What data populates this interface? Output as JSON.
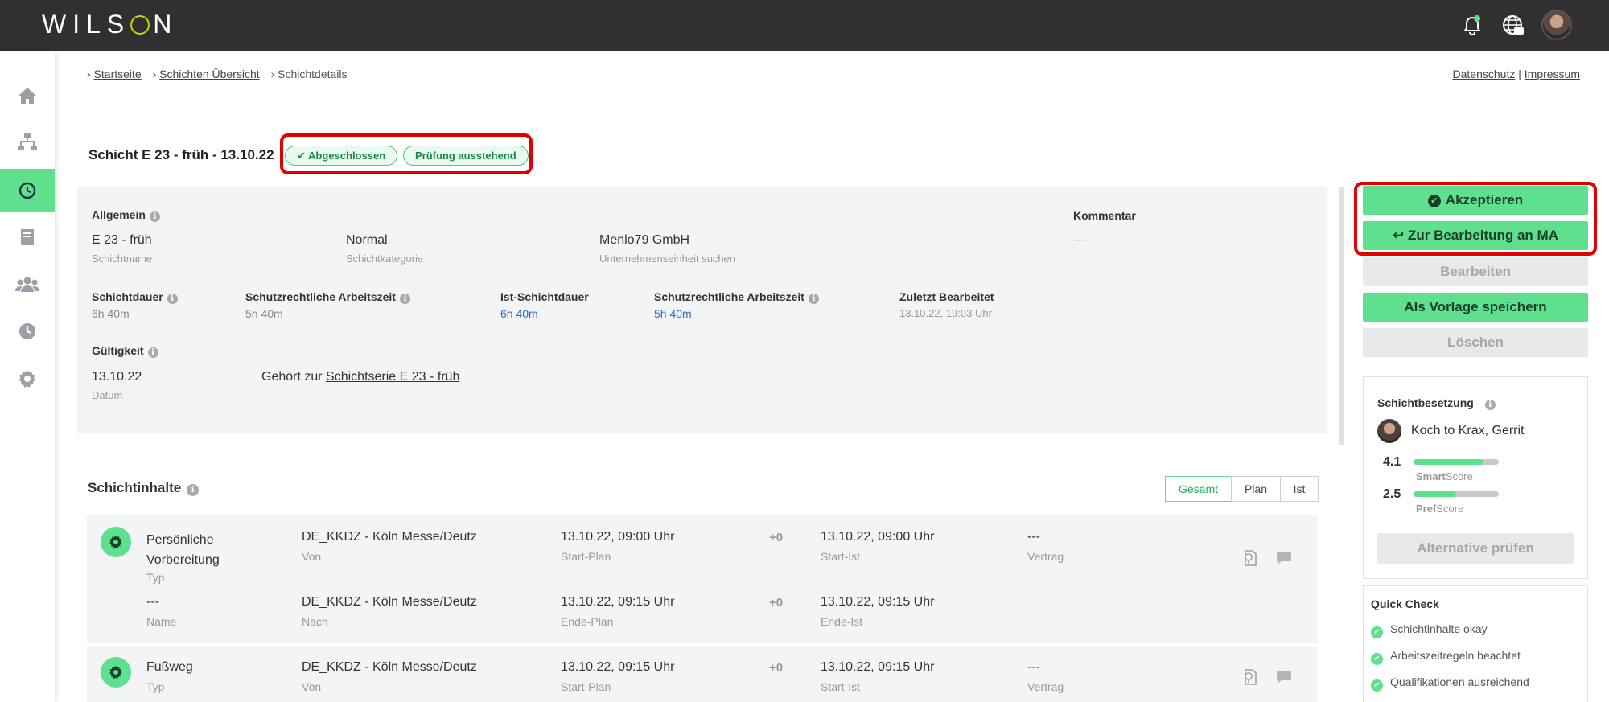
{
  "app": {
    "logo": "WILSON"
  },
  "breadcrumb": {
    "items": [
      "Startseite",
      "Schichten Übersicht",
      "Schichtdetails"
    ]
  },
  "legal": {
    "privacy": "Datenschutz",
    "separator": "|",
    "imprint": "Impressum"
  },
  "header": {
    "title": "Schicht E 23 - früh - 13.10.22",
    "badges": [
      "Abgeschlossen",
      "Prüfung ausstehend"
    ]
  },
  "general": {
    "section_label": "Allgemein",
    "shift_name": {
      "value": "E 23 - früh",
      "label": "Schichtname"
    },
    "category": {
      "value": "Normal",
      "label": "Schichtkategorie"
    },
    "unit": {
      "value": "Menlo79 GmbH",
      "label": "Unternehmenseinheit suchen"
    },
    "comment": {
      "label": "Kommentar",
      "value": "---"
    },
    "duration": {
      "label": "Schichtdauer",
      "value": "6h 40m"
    },
    "protected_time": {
      "label": "Schutzrechtliche Arbeitszeit",
      "value": "5h 40m"
    },
    "actual_duration": {
      "label": "Ist-Schichtdauer",
      "value": "6h 40m"
    },
    "protected_time_actual": {
      "label": "Schutzrechtliche Arbeitszeit",
      "value": "5h 40m"
    },
    "last_edited": {
      "label": "Zuletzt Bearbeitet",
      "value": "13.10.22, 19:03 Uhr"
    },
    "validity": {
      "label": "Gültigkeit",
      "date": "13.10.22",
      "date_label": "Datum",
      "series_prefix": "Gehört zur",
      "series_link": "Schichtserie E 23 - früh"
    }
  },
  "actions": {
    "accept": "Akzeptieren",
    "return_to_employee": "↩ Zur Bearbeitung an MA",
    "edit": "Bearbeiten",
    "save_template": "Als Vorlage speichern",
    "delete": "Löschen"
  },
  "staffing": {
    "title": "Schichtbesetzung",
    "employee": "Koch to Krax, Gerrit",
    "smart_score": {
      "value": "4.1",
      "bold": "Smart",
      "rest": "Score",
      "fraction": 0.82
    },
    "pref_score": {
      "value": "2.5",
      "bold": "Pref",
      "rest": "Score",
      "fraction": 0.5
    },
    "check_alternative": "Alternative prüfen"
  },
  "quick_check": {
    "title": "Quick Check",
    "items": [
      "Schichtinhalte okay",
      "Arbeitszeitregeln beachtet",
      "Qualifikationen ausreichend"
    ]
  },
  "contents": {
    "title": "Schichtinhalte",
    "tabs": [
      "Gesamt",
      "Plan",
      "Ist"
    ],
    "rows": [
      {
        "type_value": "Persönliche Vorbereitung",
        "type_label": "Typ",
        "name_value": "---",
        "name_label": "Name",
        "from_value": "DE_KKDZ - Köln Messe/Deutz",
        "from_label": "Von",
        "to_value": "DE_KKDZ - Köln Messe/Deutz",
        "to_label": "Nach",
        "start_plan": "13.10.22, 09:00 Uhr",
        "start_plan_label": "Start-Plan",
        "end_plan": "13.10.22, 09:15 Uhr",
        "end_plan_label": "Ende-Plan",
        "delta_start": "+0",
        "delta_end": "+0",
        "start_actual": "13.10.22, 09:00 Uhr",
        "start_actual_label": "Start-Ist",
        "end_actual": "13.10.22, 09:15 Uhr",
        "end_actual_label": "Ende-Ist",
        "contract_value": "---",
        "contract_label": "Vertrag"
      },
      {
        "type_value": "Fußweg",
        "type_label": "Typ",
        "from_value": "DE_KKDZ - Köln Messe/Deutz",
        "from_label": "Von",
        "start_plan": "13.10.22, 09:15 Uhr",
        "start_plan_label": "Start-Plan",
        "delta_start": "+0",
        "start_actual": "13.10.22, 09:15 Uhr",
        "start_actual_label": "Start-Ist",
        "contract_value": "---",
        "contract_label": "Vertrag"
      }
    ]
  },
  "colors": {
    "accent": "#5ee08f",
    "topbar": "#303030",
    "highlight": "#e00000",
    "link_blue": "#2d6cc0"
  }
}
